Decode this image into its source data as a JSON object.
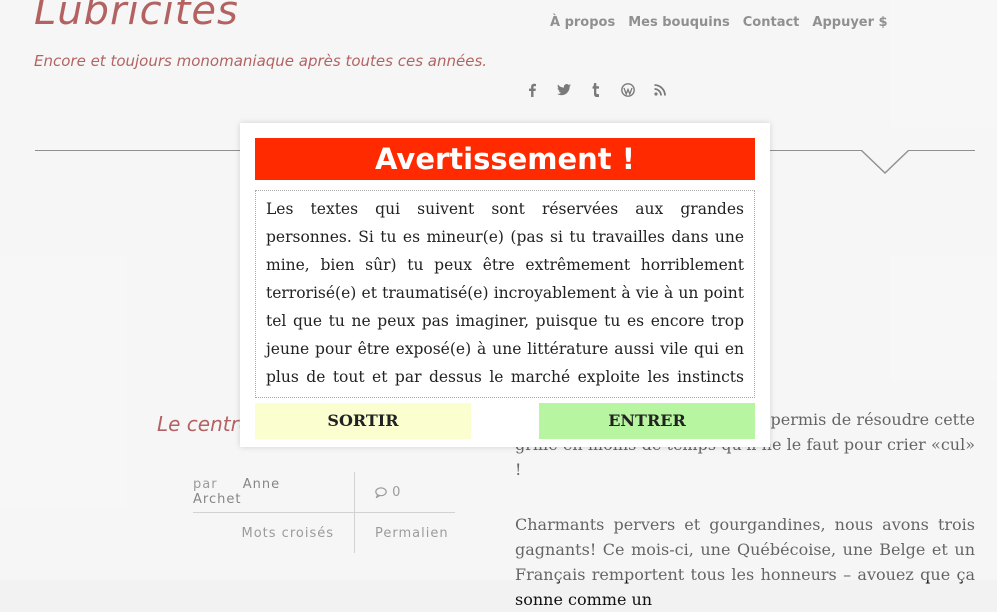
{
  "header": {
    "site_title": "Lubricités",
    "tagline": "Encore et toujours monomaniaque après toutes ces années.",
    "nav": [
      "À propos",
      "Mes bouquins",
      "Contact",
      "Appuyer $"
    ],
    "social_icons": [
      "facebook-icon",
      "twitter-icon",
      "tumblr-icon",
      "wordpress-icon",
      "rss-icon"
    ]
  },
  "post": {
    "title_partial": "Le centre",
    "meta": {
      "by_label": "par",
      "author": "Anne Archet",
      "comment_count": "0",
      "category": "Mots croisés",
      "permalink": "Permalien"
    },
    "para1_visible": "a plus facile et celle qui vous a permis de résoudre cette grille en moins de temps qu'il ne le faut pour crier «cul» !",
    "para2": "Charmants pervers et gourgandines, nous avons trois gagnants! Ce mois-ci, une Québécoise, une Belge et un Français remportent tous les honneurs – avouez que ça sonne comme un"
  },
  "modal": {
    "title": "Avertissement !",
    "body": "Les textes qui suivent sont réservées aux grandes personnes. Si tu es mineur(e) (pas si tu travailles dans une mine, bien sûr) tu peux être extrêmement horriblement terrorisé(e) et traumatisé(e) incroyablement à vie à un point tel que tu ne peux pas imaginer, puisque tu es encore trop jeune pour être exposé(e) à une littérature aussi vile qui en plus de tout et par dessus le marché exploite les instincts les plus abjects de la nature humaine.",
    "exit_label": "SORTIR",
    "enter_label": "ENTRER"
  },
  "colors": {
    "brand": "#8b0d0d",
    "warning": "#ff2a00",
    "exit_bg": "#fbffd0",
    "enter_bg": "#b8f5a0"
  }
}
